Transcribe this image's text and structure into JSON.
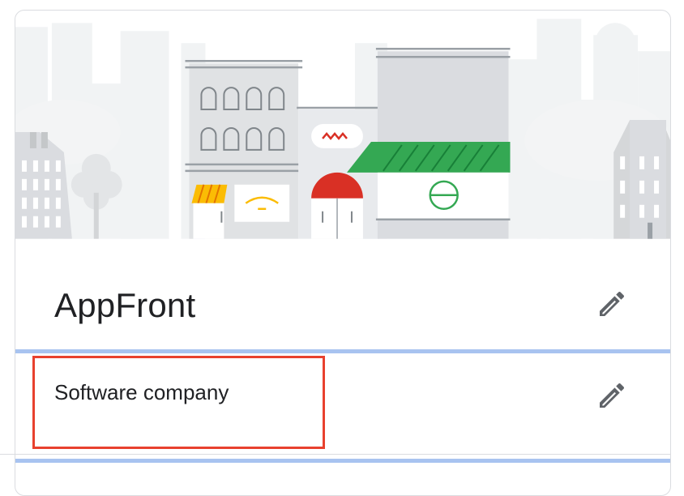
{
  "business": {
    "name": "AppFront",
    "category": "Software company"
  },
  "icons": {
    "edit_name": "pencil-icon",
    "edit_category": "pencil-icon"
  },
  "colors": {
    "divider": "#a8c3f0",
    "highlight": "#e8412e",
    "awning_green": "#34a853",
    "awning_red": "#d93025",
    "awning_yellow": "#fbbc04"
  }
}
